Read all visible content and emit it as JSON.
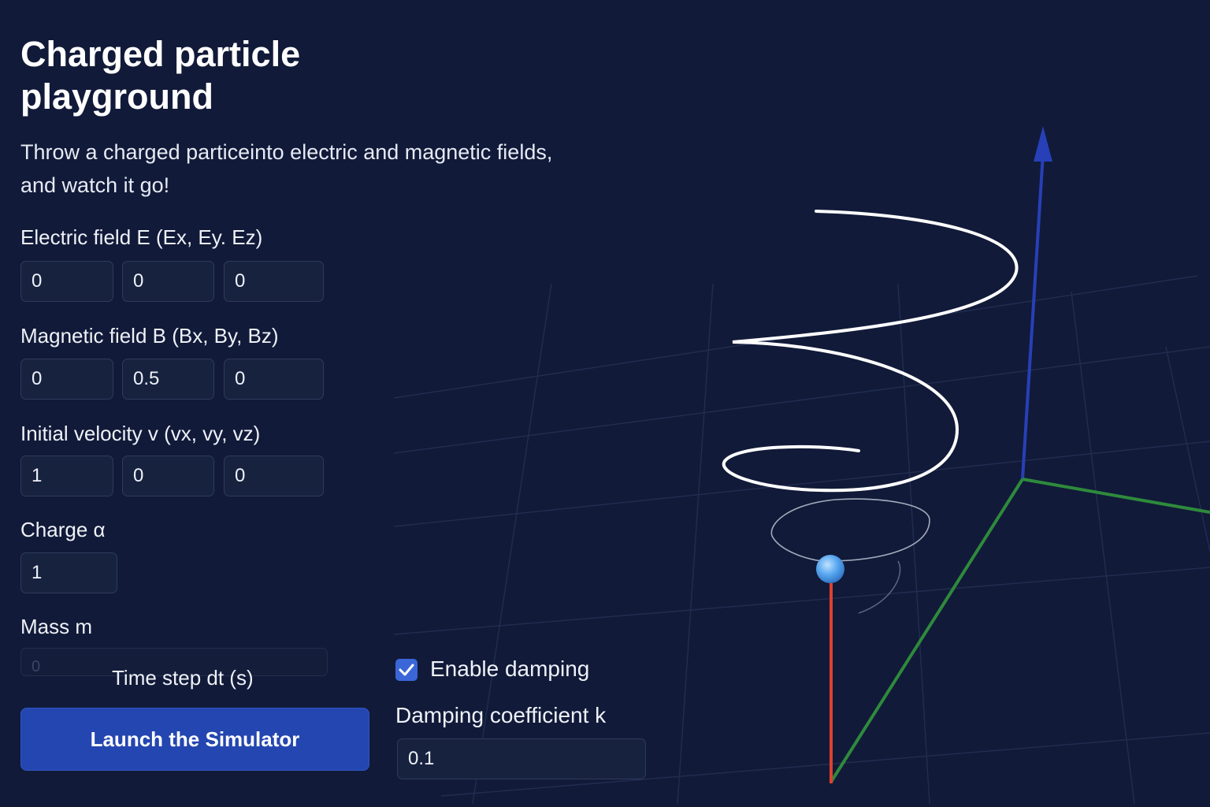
{
  "header": {
    "title": "Charged particle playground",
    "subtitle": "Throw a charged particeinto electric and magnetic fields, and watch it go!"
  },
  "electric_field": {
    "label": "Electric field E (Ex, Ey. Ez)",
    "values": [
      "0",
      "0",
      "0"
    ]
  },
  "magnetic_field": {
    "label": "Magnetic field B (Bx, By, Bz)",
    "values": [
      "0",
      "0.5",
      "0"
    ]
  },
  "initial_velocity": {
    "label": "Initial velocity v (vx, vy, vz)",
    "values": [
      "1",
      "0",
      "0"
    ]
  },
  "charge": {
    "label": "Charge α",
    "value": "1"
  },
  "mass": {
    "label": "Mass m",
    "value": "0"
  },
  "time_step": {
    "label": "Time step dt (s)"
  },
  "launch_button": {
    "label": "Launch the Simulator"
  },
  "damping": {
    "checkbox_label": "Enable damping",
    "enabled": true,
    "coefficient_label": "Damping coefficient k",
    "coefficient_value": "0.1"
  },
  "colors": {
    "background": "#111a38",
    "accent": "#2446b0",
    "axis_x": "#e0402e",
    "axis_y": "#2e8a3c",
    "axis_z": "#2740b8",
    "particle": "#5aa8f0"
  },
  "scene": {
    "particle_icon": "sphere-icon",
    "trajectory": "helix"
  }
}
